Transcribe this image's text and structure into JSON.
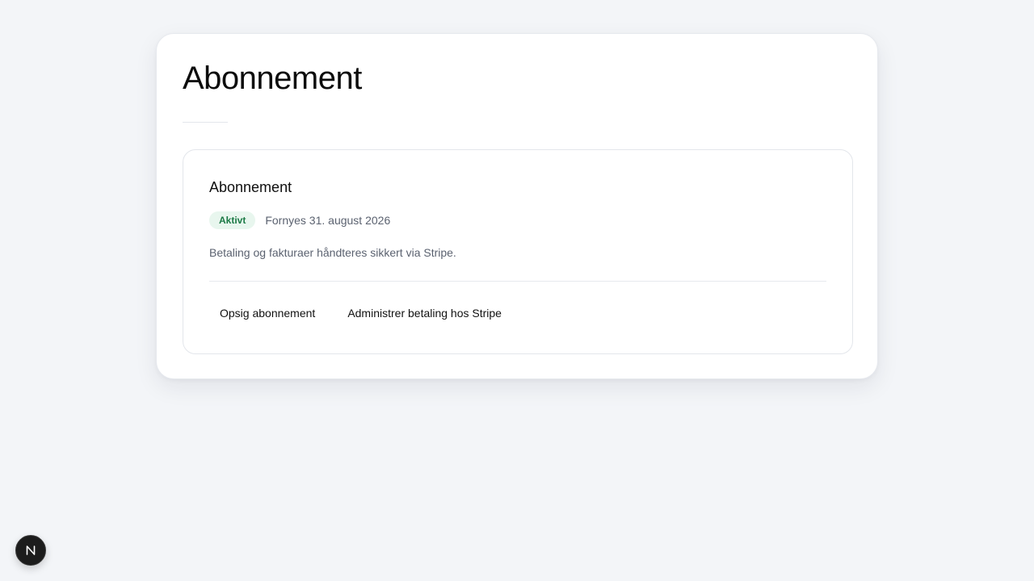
{
  "page": {
    "title": "Abonnement"
  },
  "subscription": {
    "title": "Abonnement",
    "status_label": "Aktivt",
    "renewal_text": "Fornyes 31. august 2026",
    "description": "Betaling og fakturaer håndteres sikkert via Stripe.",
    "actions": {
      "cancel_label": "Opsig abonnement",
      "manage_label": "Administrer betaling hos Stripe"
    }
  },
  "dev_indicator": {
    "icon": "nextjs-n-icon"
  },
  "colors": {
    "background": "#f3f5f8",
    "card": "#ffffff",
    "status_bg": "#e8f6ee",
    "status_text": "#1c7a46",
    "muted_text": "#5b6270"
  }
}
